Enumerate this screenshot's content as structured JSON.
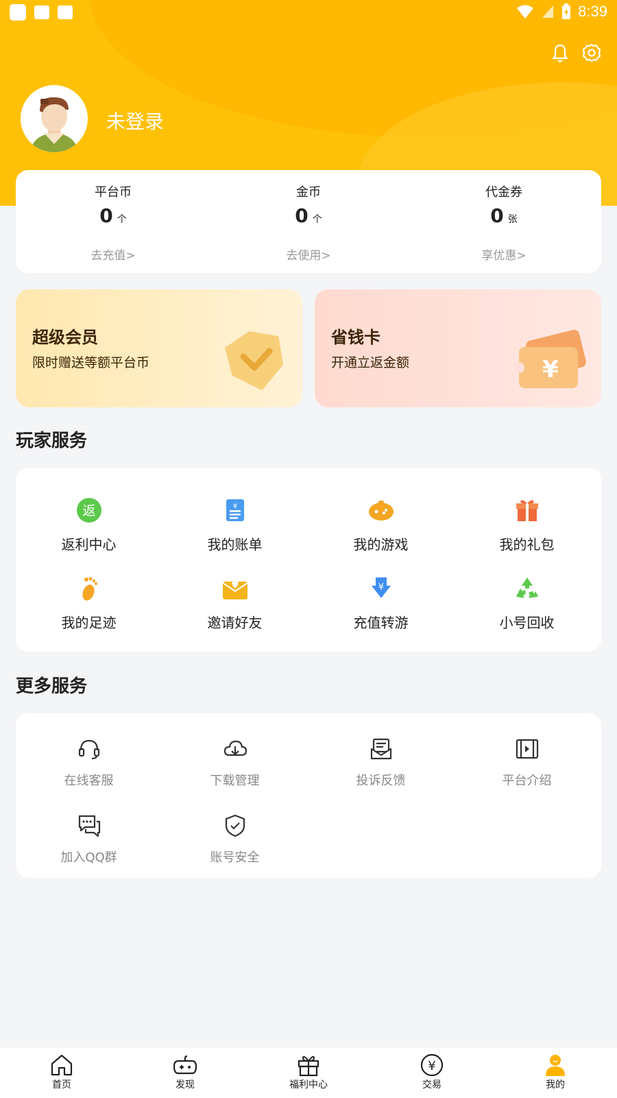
{
  "status_bar": {
    "time": "8:39"
  },
  "user": {
    "name": "未登录"
  },
  "stats": [
    {
      "label": "平台币",
      "value": "0",
      "unit": "个",
      "action": "去充值>"
    },
    {
      "label": "金币",
      "value": "0",
      "unit": "个",
      "action": "去使用>"
    },
    {
      "label": "代金券",
      "value": "0",
      "unit": "张",
      "action": "享优惠>"
    }
  ],
  "promos": {
    "vip": {
      "title": "超级会员",
      "subtitle": "限时赠送等额平台币"
    },
    "save": {
      "title": "省钱卡",
      "subtitle": "开通立返金额"
    }
  },
  "player_services": {
    "title": "玩家服务",
    "items": [
      {
        "label": "返利中心",
        "icon": "rebate-icon"
      },
      {
        "label": "我的账单",
        "icon": "bill-icon"
      },
      {
        "label": "我的游戏",
        "icon": "gamepad-icon"
      },
      {
        "label": "我的礼包",
        "icon": "gift-icon"
      },
      {
        "label": "我的足迹",
        "icon": "footprint-icon"
      },
      {
        "label": "邀请好友",
        "icon": "invite-envelope-icon"
      },
      {
        "label": "充值转游",
        "icon": "recharge-transfer-icon"
      },
      {
        "label": "小号回收",
        "icon": "recycle-icon"
      }
    ]
  },
  "more_services": {
    "title": "更多服务",
    "items": [
      {
        "label": "在线客服",
        "icon": "headset-icon"
      },
      {
        "label": "下载管理",
        "icon": "cloud-download-icon"
      },
      {
        "label": "投诉反馈",
        "icon": "feedback-icon"
      },
      {
        "label": "平台介绍",
        "icon": "video-icon"
      },
      {
        "label": "加入QQ群",
        "icon": "chat-icon"
      },
      {
        "label": "账号安全",
        "icon": "shield-icon"
      }
    ]
  },
  "rebate_badge": "返",
  "tabs": [
    {
      "label": "首页",
      "icon": "home-icon"
    },
    {
      "label": "发现",
      "icon": "gamepad-icon"
    },
    {
      "label": "福利中心",
      "icon": "gift-icon"
    },
    {
      "label": "交易",
      "icon": "yen-icon"
    },
    {
      "label": "我的",
      "icon": "user-icon"
    }
  ],
  "colors": {
    "brand": "#FFC107",
    "active_tab": "#FFB300"
  }
}
